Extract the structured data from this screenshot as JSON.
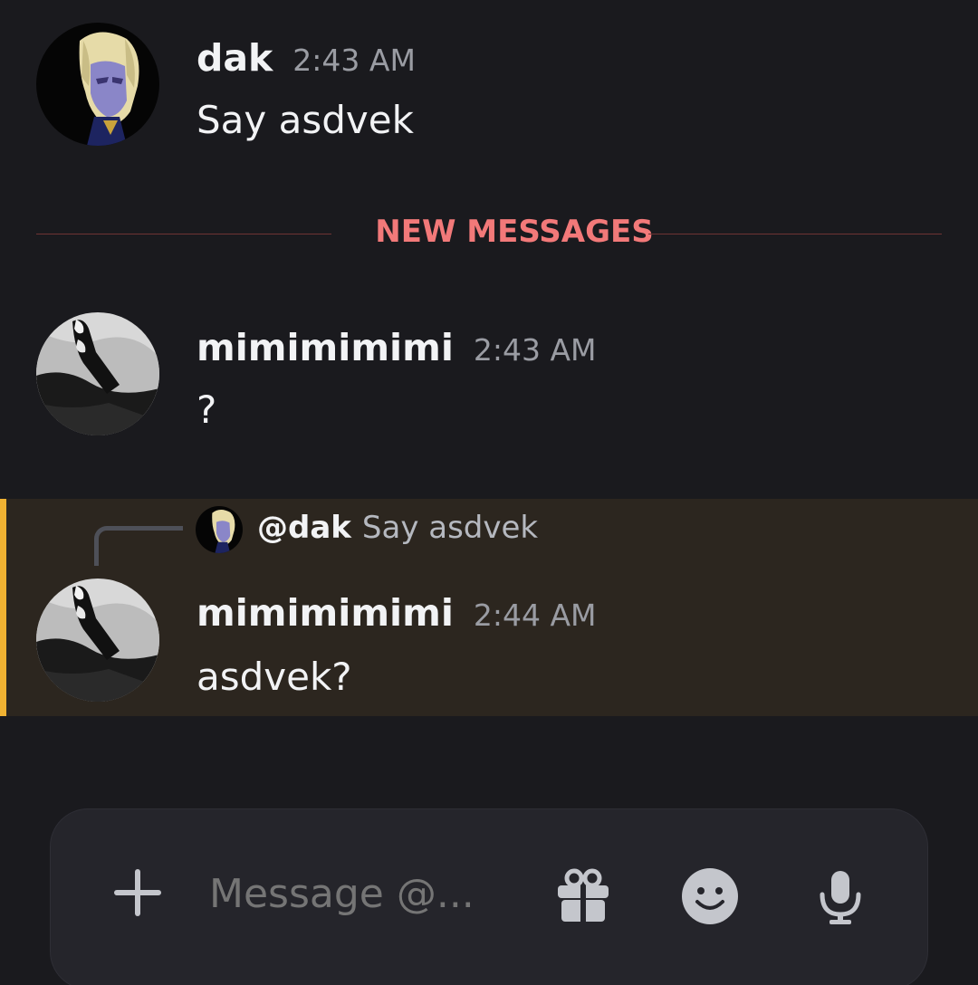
{
  "colors": {
    "background": "#1a1a1e",
    "new_messages": "#f27979",
    "mention_highlight": "#2c261f",
    "mention_bar": "#f0b232",
    "composer_bg": "#25252b"
  },
  "messages": [
    {
      "author": "dak",
      "time": "2:43 AM",
      "text": "Say asdvek",
      "avatar_icon": "anime-character-avatar"
    },
    {
      "author": "mimimimimi",
      "time": "2:43 AM",
      "text": "?",
      "avatar_icon": "monochrome-photo-avatar"
    },
    {
      "author": "mimimimimi",
      "time": "2:44 AM",
      "text": "asdvek?",
      "avatar_icon": "monochrome-photo-avatar",
      "reply": {
        "mention": "@dak",
        "preview": "Say asdvek",
        "avatar_icon": "anime-character-avatar"
      }
    }
  ],
  "divider": {
    "label": "NEW MESSAGES"
  },
  "composer": {
    "placeholder": "Message @...",
    "icons": [
      "plus-icon",
      "gift-icon",
      "emoji-icon",
      "microphone-icon"
    ]
  }
}
